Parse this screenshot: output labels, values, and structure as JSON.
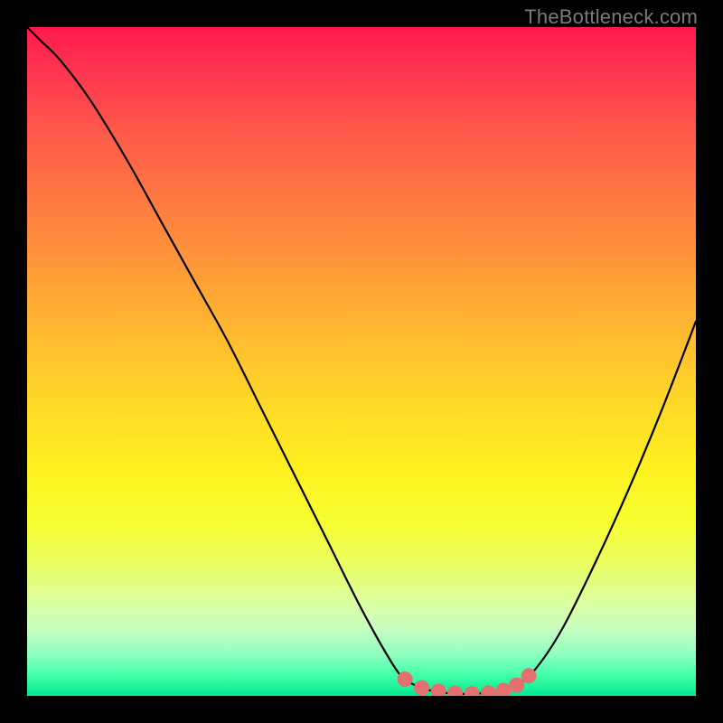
{
  "watermark": "TheBottleneck.com",
  "chart_data": {
    "type": "line",
    "title": "",
    "xlabel": "",
    "ylabel": "",
    "xlim": [
      0,
      1
    ],
    "ylim": [
      0,
      1
    ],
    "annotations": [],
    "series": [
      {
        "name": "bottleneck-curve",
        "color": "#000000",
        "points": [
          {
            "x": 0.0,
            "y": 1.0
          },
          {
            "x": 0.02,
            "y": 0.98
          },
          {
            "x": 0.05,
            "y": 0.95
          },
          {
            "x": 0.095,
            "y": 0.89
          },
          {
            "x": 0.15,
            "y": 0.8
          },
          {
            "x": 0.2,
            "y": 0.71
          },
          {
            "x": 0.25,
            "y": 0.62
          },
          {
            "x": 0.3,
            "y": 0.53
          },
          {
            "x": 0.35,
            "y": 0.43
          },
          {
            "x": 0.4,
            "y": 0.33
          },
          {
            "x": 0.45,
            "y": 0.23
          },
          {
            "x": 0.5,
            "y": 0.13
          },
          {
            "x": 0.545,
            "y": 0.05
          },
          {
            "x": 0.565,
            "y": 0.025
          },
          {
            "x": 0.59,
            "y": 0.012
          },
          {
            "x": 0.62,
            "y": 0.005
          },
          {
            "x": 0.66,
            "y": 0.003
          },
          {
            "x": 0.7,
            "y": 0.006
          },
          {
            "x": 0.73,
            "y": 0.015
          },
          {
            "x": 0.76,
            "y": 0.04
          },
          {
            "x": 0.8,
            "y": 0.1
          },
          {
            "x": 0.85,
            "y": 0.2
          },
          {
            "x": 0.9,
            "y": 0.31
          },
          {
            "x": 0.95,
            "y": 0.43
          },
          {
            "x": 1.0,
            "y": 0.56
          }
        ]
      },
      {
        "name": "highlight-dots",
        "color": "#e46f6f",
        "points": [
          {
            "x": 0.565,
            "y": 0.025
          },
          {
            "x": 0.59,
            "y": 0.012
          },
          {
            "x": 0.615,
            "y": 0.007
          },
          {
            "x": 0.64,
            "y": 0.004
          },
          {
            "x": 0.665,
            "y": 0.003
          },
          {
            "x": 0.69,
            "y": 0.004
          },
          {
            "x": 0.712,
            "y": 0.008
          },
          {
            "x": 0.732,
            "y": 0.016
          },
          {
            "x": 0.75,
            "y": 0.03
          }
        ]
      }
    ]
  }
}
